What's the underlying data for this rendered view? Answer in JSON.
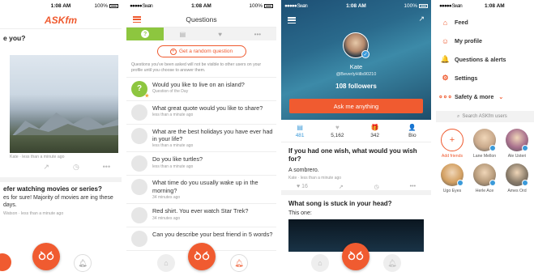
{
  "panel1": {
    "time": "1:08 AM",
    "battery": "100%",
    "logo": "ASKfm",
    "question_partial": "e you?",
    "photo_meta": "Kate · less than a minute ago",
    "question2": "efer watching movies or series?",
    "answer2": "es for sure! Majority of movies are ing these days.",
    "answer2_meta": "Watson · less than a minute ago"
  },
  "panel2": {
    "carrier": "●●●●● Swan",
    "time": "1:08 AM",
    "battery": "100%",
    "title": "Questions",
    "random_btn": "Get a random question",
    "note": "Questions you've been asked will not be visible to other users on your profile until you choose to answer them.",
    "questions": [
      {
        "text": "Would you like to live on an island?",
        "meta": "Question of the Day",
        "icon": "?",
        "green": true
      },
      {
        "text": "What great quote would you like to share?",
        "meta": "less than a minute ago",
        "icon": "",
        "green": false
      },
      {
        "text": "What are the best holidays you have ever had in your life?",
        "meta": "less than a minute ago",
        "icon": "",
        "green": false
      },
      {
        "text": "Do you like turtles?",
        "meta": "less than a minute ago",
        "icon": "",
        "green": false
      },
      {
        "text": "What time do you usually wake up in the morning?",
        "meta": "34 minutes ago",
        "icon": "",
        "green": false
      },
      {
        "text": "Red shirt. You ever watch Star Trek?",
        "meta": "34 minutes ago",
        "icon": "",
        "green": false
      },
      {
        "text": "Can you describe your best friend in 5 words?",
        "meta": "",
        "icon": "",
        "green": false
      }
    ]
  },
  "panel3": {
    "carrier": "●●●●● Swan",
    "time": "1:08 AM",
    "battery": "100%",
    "name": "Kate",
    "handle": "@BeverlyHills90210",
    "followers": "108 followers",
    "ask_btn": "Ask me anything",
    "stats": [
      {
        "icon": "▤",
        "value": "481",
        "active": true
      },
      {
        "icon": "♥",
        "value": "5,162",
        "active": false
      },
      {
        "icon": "🎁",
        "value": "342",
        "active": false
      },
      {
        "icon": "👤",
        "value": "Bio",
        "active": false
      }
    ],
    "q1": "If you had one wish, what would you wish for?",
    "a1": "A sombrero.",
    "a1_meta": "Kate · less than a minute ago",
    "likes": "16",
    "q2": "What song is stuck in your head?",
    "a2": "This one:"
  },
  "panel4": {
    "carrier": "●●●●● Swan",
    "time": "1:08 AM",
    "menu": [
      {
        "label": "Feed",
        "icon": "⌂"
      },
      {
        "label": "My profile",
        "icon": "☺"
      },
      {
        "label": "Questions & alerts",
        "icon": "🔔"
      },
      {
        "label": "Settings",
        "icon": "⚙"
      },
      {
        "label": "Safety & more",
        "icon": "∘∘∘"
      }
    ],
    "search_placeholder": "Search ASKfm users",
    "users": [
      {
        "name": "Add friends",
        "color": "#ffffff"
      },
      {
        "name": "Lane Mellon",
        "color": "#c9a98b"
      },
      {
        "name": "Ale Usteri",
        "color": "#a8708d"
      },
      {
        "name": "Ugo Eyes",
        "color": "#d3a062"
      },
      {
        "name": "Herle Ace",
        "color": "#b69a7a"
      },
      {
        "name": "Ames Ord",
        "color": "#8a7c6a"
      }
    ]
  }
}
